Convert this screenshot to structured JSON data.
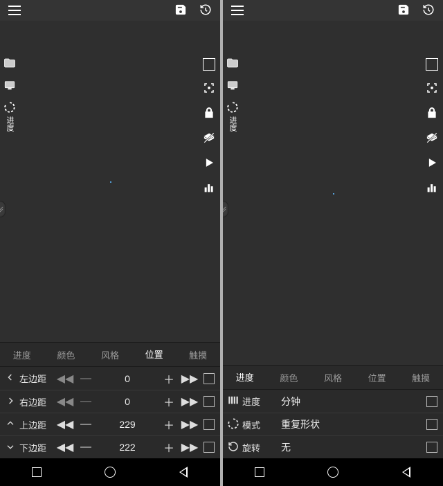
{
  "left": {
    "left_rail": {
      "progress_label": "进度"
    },
    "tabs": [
      {
        "label": "进度",
        "active": false
      },
      {
        "label": "颜色",
        "active": false
      },
      {
        "label": "风格",
        "active": false
      },
      {
        "label": "位置",
        "active": true
      },
      {
        "label": "触摸",
        "active": false
      }
    ],
    "rows": [
      {
        "icon": "arrow-left",
        "label": "左边距",
        "value": "0"
      },
      {
        "icon": "arrow-right",
        "label": "右边距",
        "value": "0"
      },
      {
        "icon": "arrow-up",
        "label": "上边距",
        "value": "229"
      },
      {
        "icon": "arrow-down",
        "label": "下边距",
        "value": "222"
      }
    ]
  },
  "right": {
    "left_rail": {
      "progress_label": "进度"
    },
    "tabs": [
      {
        "label": "进度",
        "active": true
      },
      {
        "label": "颜色",
        "active": false
      },
      {
        "label": "风格",
        "active": false
      },
      {
        "label": "位置",
        "active": false
      },
      {
        "label": "触摸",
        "active": false
      }
    ],
    "rows": [
      {
        "icon": "bars",
        "label": "进度",
        "value": "分钟"
      },
      {
        "icon": "ring",
        "label": "模式",
        "value": "重复形状"
      },
      {
        "icon": "rotate",
        "label": "旋转",
        "value": "无"
      }
    ]
  }
}
